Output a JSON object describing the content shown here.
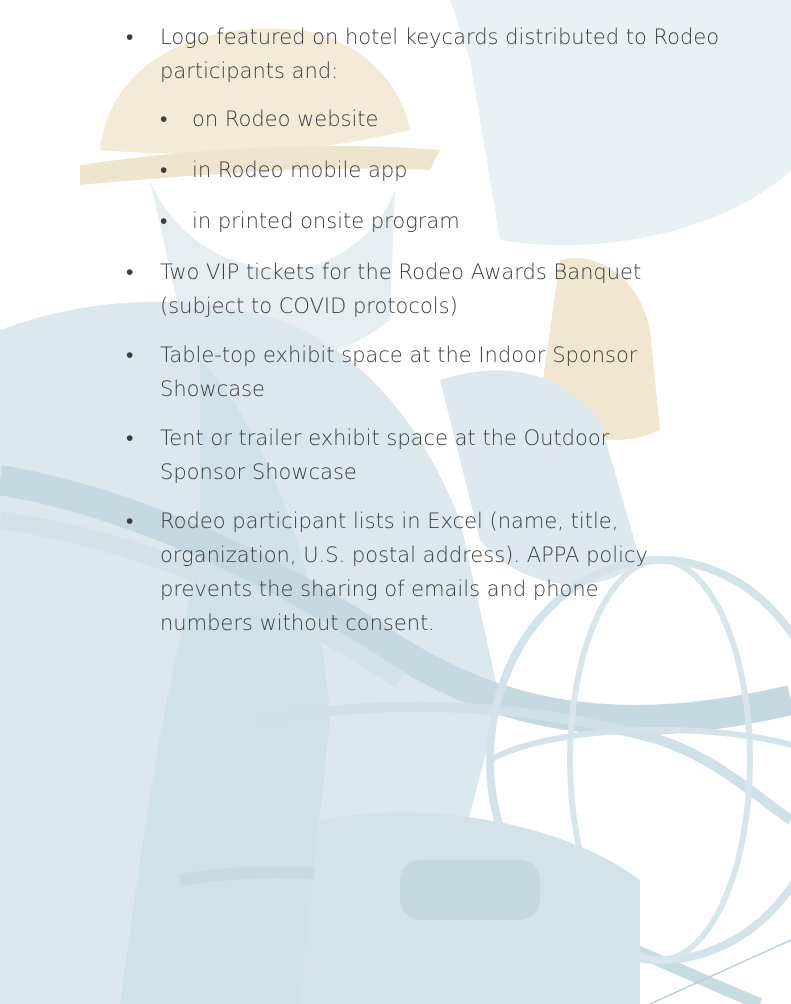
{
  "list": {
    "items": [
      {
        "text": "Logo featured on hotel keycards distributed to Rodeo participants and:",
        "subitems": [
          "on Rodeo website",
          "in Rodeo mobile app",
          "in printed onsite program"
        ]
      },
      {
        "text": "Two VIP tickets for the Rodeo Awards Banquet (subject to COVID protocols)"
      },
      {
        "text": "Table-top exhibit space at the Indoor Sponsor Showcase"
      },
      {
        "text": "Tent or trailer exhibit space at the Outdoor Sponsor Showcase"
      },
      {
        "text": "Rodeo participant lists in Excel (name, title, organization, U.S. postal address). APPA policy prevents the sharing of emails and phone numbers without consent."
      }
    ]
  },
  "bullet_glyph": "•",
  "colors": {
    "text": "#3d3d3d",
    "background_tint": "#c9dde6"
  }
}
